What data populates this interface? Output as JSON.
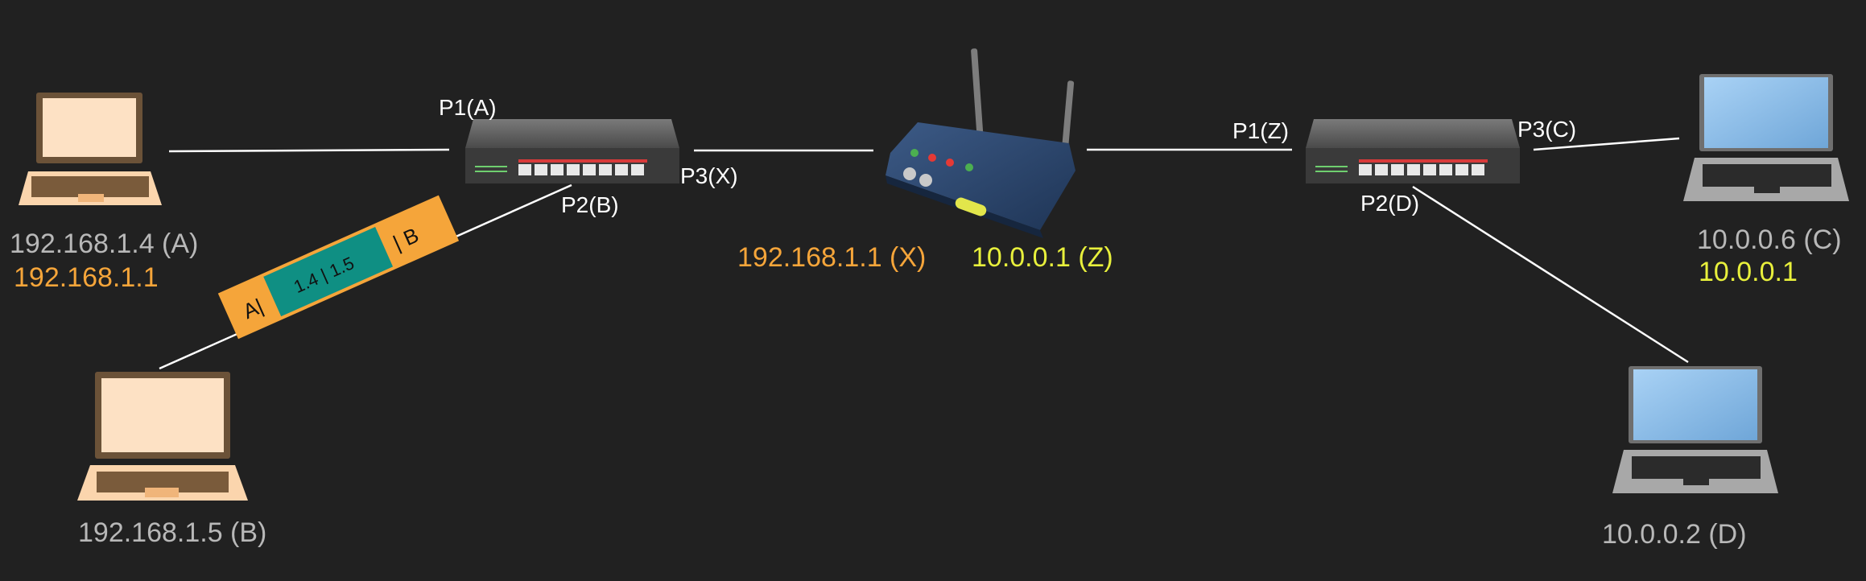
{
  "colors": {
    "background": "#212121",
    "link": "#ffffff",
    "label_gray": "#b8b8b8",
    "label_orange": "#f5a53a",
    "label_yellow": "#e8f03c",
    "packet_outer": "#f5a53a",
    "packet_inner": "#0f8f83"
  },
  "hosts": {
    "a": {
      "ip": "192.168.1.4 (A)",
      "gateway": "192.168.1.1"
    },
    "b": {
      "ip": "192.168.1.5 (B)"
    },
    "c": {
      "ip": "10.0.0.6 (C)",
      "gateway": "10.0.0.1"
    },
    "d": {
      "ip": "10.0.0.2 (D)"
    }
  },
  "switch_left": {
    "p1": "P1(A)",
    "p2": "P2(B)",
    "p3": "P3(X)"
  },
  "switch_right": {
    "p1": "P1(Z)",
    "p2": "P2(D)",
    "p3": "P3(C)"
  },
  "router": {
    "ip_left": "192.168.1.1 (X)",
    "ip_right": "10.0.0.1 (Z)"
  },
  "packet": {
    "outer_left": "A|",
    "inner": "1.4 | 1.5",
    "outer_right": "| B"
  }
}
